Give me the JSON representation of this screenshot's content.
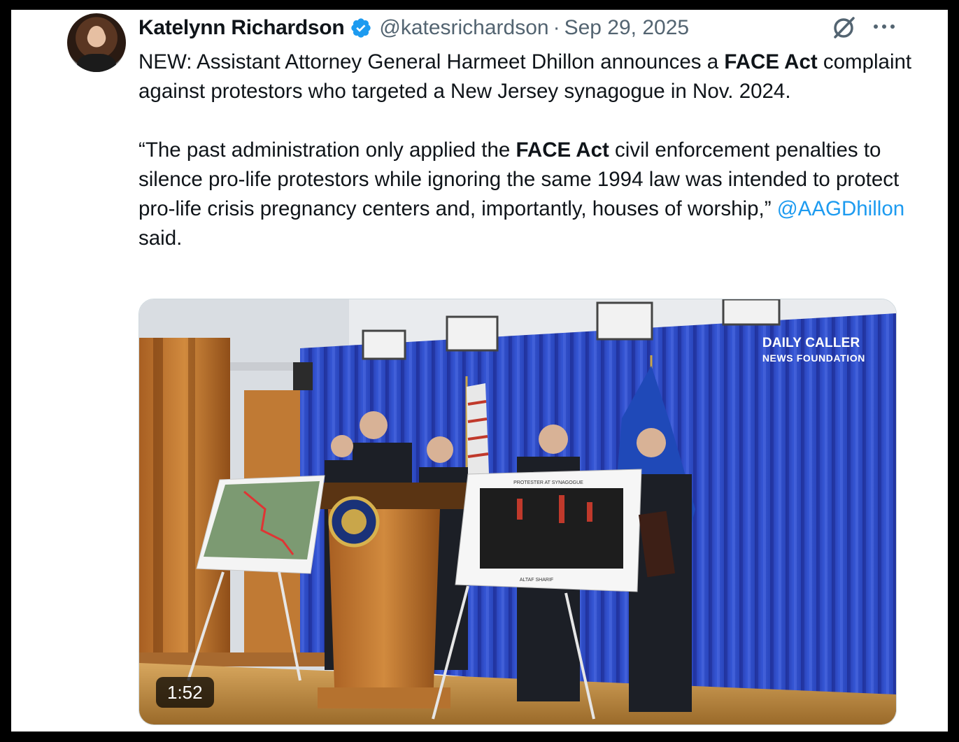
{
  "post": {
    "author_name": "Katelynn Richardson",
    "handle": "@katesrichardson",
    "separator": "·",
    "date": "Sep 29, 2025",
    "text": {
      "p1_a": "NEW: Assistant Attorney General Harmeet Dhillon announces a ",
      "p1_bold": "FACE Act",
      "p1_b": " complaint against protestors who targeted a New Jersey synagogue in Nov. 2024.",
      "p2_a": "“The past administration only applied the ",
      "p2_bold": "FACE Act",
      "p2_b": " civil enforcement penalties to silence pro-life protestors while ignoring the same 1994 law was intended to protect pro-life crisis pregnancy centers and, importantly, houses of worship,” ",
      "p2_mention": "@AAGDhillon",
      "p2_c": " said."
    }
  },
  "media": {
    "duration": "1:52",
    "watermark_title": "DAILY CALLER",
    "watermark_sub": "NEWS FOUNDATION",
    "poster_title": "PROTESTER AT SYNAGOGUE",
    "poster_caption": "ALTAF SHARIF"
  },
  "colors": {
    "mention": "#1d9bf0",
    "verified": "#1d9bf0",
    "text": "#0f1419",
    "muted": "#536471",
    "curtain": "#2f4fc4"
  },
  "icons": [
    "verified-badge-icon",
    "grok-icon",
    "more-icon"
  ]
}
